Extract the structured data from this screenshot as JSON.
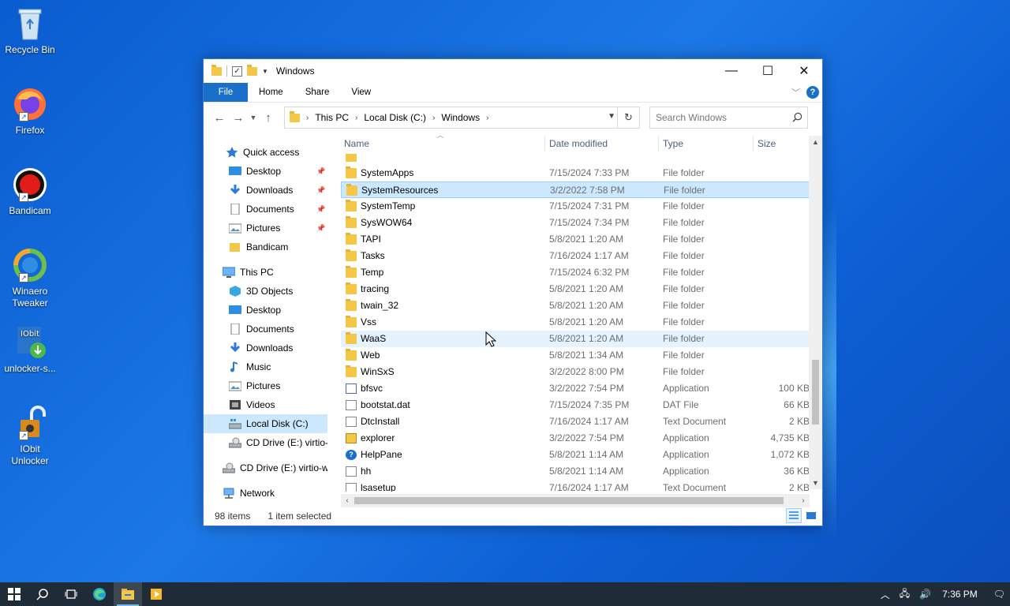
{
  "desktop": {
    "icons": [
      {
        "label": "Recycle Bin"
      },
      {
        "label": "Firefox"
      },
      {
        "label": "Bandicam"
      },
      {
        "label": "Winaero Tweaker"
      },
      {
        "label": "unlocker-s..."
      },
      {
        "label": "IObit Unlocker"
      }
    ]
  },
  "window": {
    "title": "Windows",
    "ribbon_tabs": [
      "File",
      "Home",
      "Share",
      "View"
    ],
    "breadcrumb": [
      "This PC",
      "Local Disk (C:)",
      "Windows"
    ],
    "search_placeholder": "Search Windows"
  },
  "navpane": {
    "items": [
      {
        "label": "Quick access"
      },
      {
        "label": "Desktop"
      },
      {
        "label": "Downloads"
      },
      {
        "label": "Documents"
      },
      {
        "label": "Pictures"
      },
      {
        "label": "Bandicam"
      },
      {
        "label": "This PC"
      },
      {
        "label": "3D Objects"
      },
      {
        "label": "Desktop"
      },
      {
        "label": "Documents"
      },
      {
        "label": "Downloads"
      },
      {
        "label": "Music"
      },
      {
        "label": "Pictures"
      },
      {
        "label": "Videos"
      },
      {
        "label": "Local Disk (C:)"
      },
      {
        "label": "CD Drive (E:) virtio-w"
      },
      {
        "label": "CD Drive (E:) virtio-w"
      },
      {
        "label": "Network"
      }
    ]
  },
  "columns": {
    "name": "Name",
    "date": "Date modified",
    "type": "Type",
    "size": "Size"
  },
  "files": [
    {
      "name": "SystemApps",
      "date": "7/15/2024 7:33 PM",
      "type": "File folder",
      "size": ""
    },
    {
      "name": "SystemResources",
      "date": "3/2/2022 7:58 PM",
      "type": "File folder",
      "size": ""
    },
    {
      "name": "SystemTemp",
      "date": "7/15/2024 7:31 PM",
      "type": "File folder",
      "size": ""
    },
    {
      "name": "SysWOW64",
      "date": "7/15/2024 7:34 PM",
      "type": "File folder",
      "size": ""
    },
    {
      "name": "TAPI",
      "date": "5/8/2021 1:20 AM",
      "type": "File folder",
      "size": ""
    },
    {
      "name": "Tasks",
      "date": "7/16/2024 1:17 AM",
      "type": "File folder",
      "size": ""
    },
    {
      "name": "Temp",
      "date": "7/15/2024 6:32 PM",
      "type": "File folder",
      "size": ""
    },
    {
      "name": "tracing",
      "date": "5/8/2021 1:20 AM",
      "type": "File folder",
      "size": ""
    },
    {
      "name": "twain_32",
      "date": "5/8/2021 1:20 AM",
      "type": "File folder",
      "size": ""
    },
    {
      "name": "Vss",
      "date": "5/8/2021 1:20 AM",
      "type": "File folder",
      "size": ""
    },
    {
      "name": "WaaS",
      "date": "5/8/2021 1:20 AM",
      "type": "File folder",
      "size": ""
    },
    {
      "name": "Web",
      "date": "5/8/2021 1:34 AM",
      "type": "File folder",
      "size": ""
    },
    {
      "name": "WinSxS",
      "date": "3/2/2022 8:00 PM",
      "type": "File folder",
      "size": ""
    },
    {
      "name": "bfsvc",
      "date": "3/2/2022 7:54 PM",
      "type": "Application",
      "size": "100 KB"
    },
    {
      "name": "bootstat.dat",
      "date": "7/15/2024 7:35 PM",
      "type": "DAT File",
      "size": "66 KB"
    },
    {
      "name": "DtcInstall",
      "date": "7/16/2024 1:17 AM",
      "type": "Text Document",
      "size": "2 KB"
    },
    {
      "name": "explorer",
      "date": "3/2/2022 7:54 PM",
      "type": "Application",
      "size": "4,735 KB"
    },
    {
      "name": "HelpPane",
      "date": "5/8/2021 1:14 AM",
      "type": "Application",
      "size": "1,072 KB"
    },
    {
      "name": "hh",
      "date": "5/8/2021 1:14 AM",
      "type": "Application",
      "size": "36 KB"
    },
    {
      "name": "lsasetup",
      "date": "7/16/2024 1:17 AM",
      "type": "Text Document",
      "size": "2 KB"
    }
  ],
  "status": {
    "items": "98 items",
    "selected": "1 item selected"
  },
  "taskbar": {
    "time": "7:36 PM"
  }
}
